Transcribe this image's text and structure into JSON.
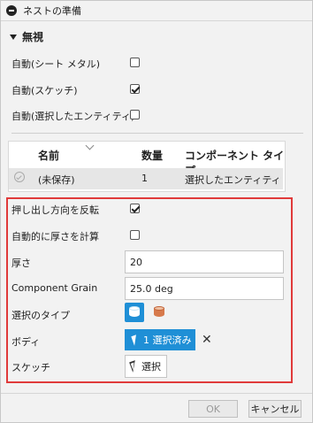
{
  "dialog": {
    "title": "ネストの準備",
    "section_title": "無視"
  },
  "ignore_options": [
    {
      "label": "自動(シート メタル)",
      "checked": false
    },
    {
      "label": "自動(スケッチ)",
      "checked": true
    },
    {
      "label": "自動(選択したエンティティ)",
      "checked": false
    }
  ],
  "table": {
    "headers": {
      "name": "名前",
      "quantity": "数量",
      "component_type": "コンポーネント タイプ"
    },
    "rows": [
      {
        "name": "(未保存)",
        "quantity": "1",
        "component_type": "選択したエンティティ"
      }
    ]
  },
  "settings": {
    "flip_extrude": {
      "label": "押し出し方向を反転",
      "checked": true
    },
    "auto_thickness": {
      "label": "自動的に厚さを計算",
      "checked": false
    },
    "thickness": {
      "label": "厚さ",
      "value": "20"
    },
    "grain": {
      "label": "Component Grain",
      "value": "25.0 deg"
    },
    "selection_type": {
      "label": "選択のタイプ",
      "icons": [
        "body-select-icon",
        "component-select-icon"
      ]
    },
    "body": {
      "label": "ボディ",
      "button": "1 選択済み"
    },
    "sketch": {
      "label": "スケッチ",
      "button": "選択"
    }
  },
  "footer": {
    "ok": "OK",
    "cancel": "キャンセル"
  },
  "colors": {
    "accent": "#1f8fd6",
    "highlight_border": "#e03a3a"
  }
}
